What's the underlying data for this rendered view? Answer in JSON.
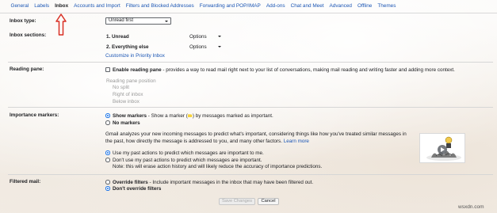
{
  "tabs": [
    {
      "label": "General"
    },
    {
      "label": "Labels"
    },
    {
      "label": "Inbox"
    },
    {
      "label": "Accounts and Import"
    },
    {
      "label": "Filters and Blocked Addresses"
    },
    {
      "label": "Forwarding and POP/IMAP"
    },
    {
      "label": "Add-ons"
    },
    {
      "label": "Chat and Meet"
    },
    {
      "label": "Advanced"
    },
    {
      "label": "Offline"
    },
    {
      "label": "Themes"
    }
  ],
  "active_tab": "Inbox",
  "inbox_type": {
    "label": "Inbox type:",
    "value": "Unread first"
  },
  "inbox_sections": {
    "label": "Inbox sections:",
    "items": [
      {
        "name": "1. Unread",
        "option": "Options"
      },
      {
        "name": "2. Everything else",
        "option": "Options"
      }
    ],
    "customize_link": "Customize in Priority Inbox"
  },
  "reading_pane": {
    "label": "Reading pane:",
    "enable_title": "Enable reading pane",
    "enable_desc": " - provides a way to read mail right next to your list of conversations, making mail reading and writing faster and adding more context.",
    "position_title": "Reading pane position",
    "positions": [
      "No split",
      "Right of inbox",
      "Below inbox"
    ]
  },
  "importance_markers": {
    "label": "Importance markers:",
    "show_title": "Show markers",
    "show_desc_before": " - Show a marker (",
    "show_desc_after": ") by messages marked as important.",
    "no_markers": "No markers",
    "info_line1": "Gmail analyzes your new incoming messages to predict what's important, considering things like how you've treated similar messages in",
    "info_line2": "the past, how directly the message is addressed to you, and many other factors.",
    "learn_more": "Learn more",
    "use_past": "Use my past actions to predict which messages are important to me.",
    "dont_use_past": "Don't use my past actions to predict which messages are important.",
    "note": "Note: this will erase action history and will likely reduce the accuracy of importance predictions."
  },
  "filtered_mail": {
    "label": "Filtered mail:",
    "override_title": "Override filters",
    "override_desc": " - Include important messages in the inbox that may have been filtered out.",
    "dont_override": "Don't override filters"
  },
  "buttons": {
    "save": "Save Changes",
    "cancel": "Cancel"
  },
  "watermark": "wsxdn.com",
  "colors": {
    "link": "#1a55b4",
    "arrow": "#d93025",
    "radio_selected": "#1a73e8",
    "marker": "#f6d23b"
  }
}
